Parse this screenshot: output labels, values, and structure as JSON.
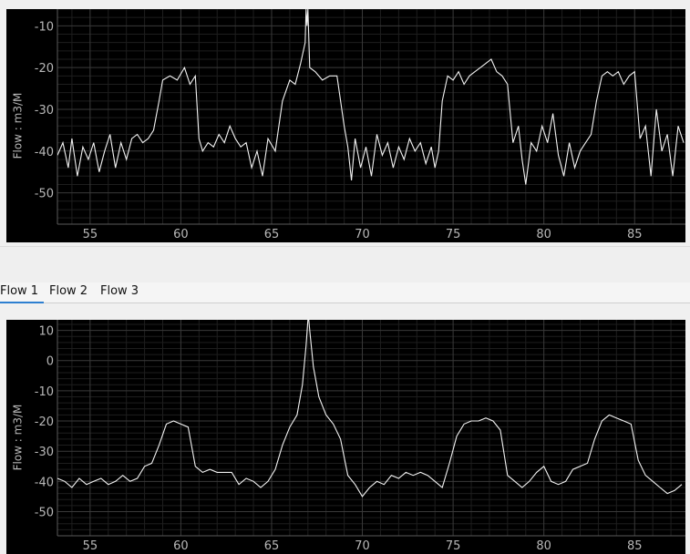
{
  "colors": {
    "plot_bg": "#000000",
    "grid": "#3a3a3a",
    "axis_text": "#b8b8b8",
    "line": "#f2f2f2",
    "tab_accent": "#2d7fd0"
  },
  "tabs": [
    {
      "label": "Flow 1",
      "active": true
    },
    {
      "label": "Flow 2",
      "active": false
    },
    {
      "label": "Flow 3",
      "active": false
    }
  ],
  "chart_data": [
    {
      "type": "line",
      "ylabel": "Flow : m3/M",
      "xlim": [
        53.2,
        87.8
      ],
      "ylim": [
        -57.5,
        -6
      ],
      "xticks": [
        55,
        60,
        65,
        70,
        75,
        80,
        85
      ],
      "yticks": [
        -10,
        -20,
        -30,
        -40,
        -50
      ],
      "grid": true,
      "series": [
        {
          "x": [
            53.2,
            53.5,
            53.8,
            54.0,
            54.3,
            54.6,
            54.9,
            55.2,
            55.5,
            55.8,
            56.1,
            56.4,
            56.7,
            57.0,
            57.3,
            57.6,
            57.9,
            58.2,
            58.5,
            58.8,
            59.0,
            59.4,
            59.8,
            60.2,
            60.5,
            60.8,
            61.0,
            61.2,
            61.5,
            61.8,
            62.1,
            62.4,
            62.7,
            63.0,
            63.3,
            63.6,
            63.9,
            64.2,
            64.5,
            64.8,
            65.2,
            65.6,
            66.0,
            66.3,
            66.6,
            66.85,
            66.9,
            66.95,
            67.0,
            67.05,
            67.1,
            67.4,
            67.8,
            68.2,
            68.6,
            69.0,
            69.2,
            69.4,
            69.6,
            69.9,
            70.2,
            70.5,
            70.8,
            71.1,
            71.4,
            71.7,
            72.0,
            72.3,
            72.6,
            72.9,
            73.2,
            73.5,
            73.8,
            74.0,
            74.2,
            74.4,
            74.7,
            75.0,
            75.3,
            75.6,
            75.9,
            76.2,
            76.5,
            76.8,
            77.1,
            77.4,
            77.7,
            78.0,
            78.3,
            78.6,
            78.8,
            79.0,
            79.3,
            79.6,
            79.9,
            80.2,
            80.5,
            80.8,
            81.1,
            81.4,
            81.7,
            82.0,
            82.3,
            82.6,
            82.9,
            83.2,
            83.5,
            83.8,
            84.1,
            84.4,
            84.7,
            85.0,
            85.3,
            85.6,
            85.9,
            86.2,
            86.5,
            86.8,
            87.1,
            87.4,
            87.7
          ],
          "y": [
            -41,
            -38,
            -44,
            -37,
            -46,
            -39,
            -42,
            -38,
            -45,
            -40,
            -36,
            -44,
            -38,
            -42,
            -37,
            -36,
            -38,
            -37,
            -35,
            -28,
            -23,
            -22,
            -23,
            -20,
            -24,
            -22,
            -37,
            -40,
            -38,
            -39,
            -36,
            -38,
            -34,
            -37,
            -39,
            -38,
            -44,
            -40,
            -46,
            -37,
            -40,
            -28,
            -23,
            -24,
            -19,
            -14,
            -6,
            -10,
            -6,
            -13,
            -20,
            -21,
            -23,
            -22,
            -22,
            -34,
            -39,
            -47,
            -37,
            -44,
            -39,
            -46,
            -36,
            -41,
            -38,
            -44,
            -39,
            -42,
            -37,
            -40,
            -38,
            -43,
            -39,
            -44,
            -40,
            -28,
            -22,
            -23,
            -21,
            -24,
            -22,
            -21,
            -20,
            -19,
            -18,
            -21,
            -22,
            -24,
            -38,
            -34,
            -42,
            -48,
            -38,
            -40,
            -34,
            -38,
            -31,
            -41,
            -46,
            -38,
            -44,
            -40,
            -38,
            -36,
            -28,
            -22,
            -21,
            -22,
            -21,
            -24,
            -22,
            -21,
            -37,
            -34,
            -46,
            -30,
            -40,
            -36,
            -46,
            -34,
            -38
          ]
        }
      ]
    },
    {
      "type": "line",
      "ylabel": "Flow : m3/M",
      "xlim": [
        53.2,
        87.8
      ],
      "ylim": [
        -58,
        13.5
      ],
      "xticks": [
        55,
        60,
        65,
        70,
        75,
        80,
        85
      ],
      "yticks": [
        10,
        0,
        -10,
        -20,
        -30,
        -40,
        -50
      ],
      "grid": true,
      "series": [
        {
          "x": [
            53.2,
            53.6,
            54.0,
            54.4,
            54.8,
            55.2,
            55.6,
            56.0,
            56.4,
            56.8,
            57.2,
            57.6,
            58.0,
            58.4,
            58.8,
            59.2,
            59.6,
            60.0,
            60.4,
            60.8,
            61.2,
            61.6,
            62.0,
            62.4,
            62.8,
            63.2,
            63.6,
            64.0,
            64.4,
            64.8,
            65.2,
            65.6,
            66.0,
            66.4,
            66.7,
            66.9,
            67.0,
            67.05,
            67.1,
            67.3,
            67.6,
            68.0,
            68.4,
            68.8,
            69.2,
            69.6,
            70.0,
            70.4,
            70.8,
            71.2,
            71.6,
            72.0,
            72.4,
            72.8,
            73.2,
            73.6,
            74.0,
            74.4,
            74.8,
            75.2,
            75.6,
            76.0,
            76.4,
            76.8,
            77.2,
            77.6,
            78.0,
            78.4,
            78.8,
            79.2,
            79.6,
            80.0,
            80.4,
            80.8,
            81.2,
            81.6,
            82.0,
            82.4,
            82.8,
            83.2,
            83.6,
            84.0,
            84.4,
            84.8,
            85.2,
            85.6,
            86.0,
            86.4,
            86.8,
            87.2,
            87.6
          ],
          "y": [
            -39,
            -40,
            -42,
            -39,
            -41,
            -40,
            -39,
            -41,
            -40,
            -38,
            -40,
            -39,
            -35,
            -34,
            -28,
            -21,
            -20,
            -21,
            -22,
            -35,
            -37,
            -36,
            -37,
            -37,
            -37,
            -41,
            -39,
            -40,
            -42,
            -40,
            -36,
            -28,
            -22,
            -18,
            -8,
            5,
            13.5,
            13.5,
            10,
            -2,
            -12,
            -18,
            -21,
            -26,
            -38,
            -41,
            -45,
            -42,
            -40,
            -41,
            -38,
            -39,
            -37,
            -38,
            -37,
            -38,
            -40,
            -42,
            -34,
            -25,
            -21,
            -20,
            -20,
            -19,
            -20,
            -23,
            -38,
            -40,
            -42,
            -40,
            -37,
            -35,
            -40,
            -41,
            -40,
            -36,
            -35,
            -34,
            -26,
            -20,
            -18,
            -19,
            -20,
            -21,
            -33,
            -38,
            -40,
            -42,
            -44,
            -43,
            -41
          ]
        }
      ]
    }
  ]
}
